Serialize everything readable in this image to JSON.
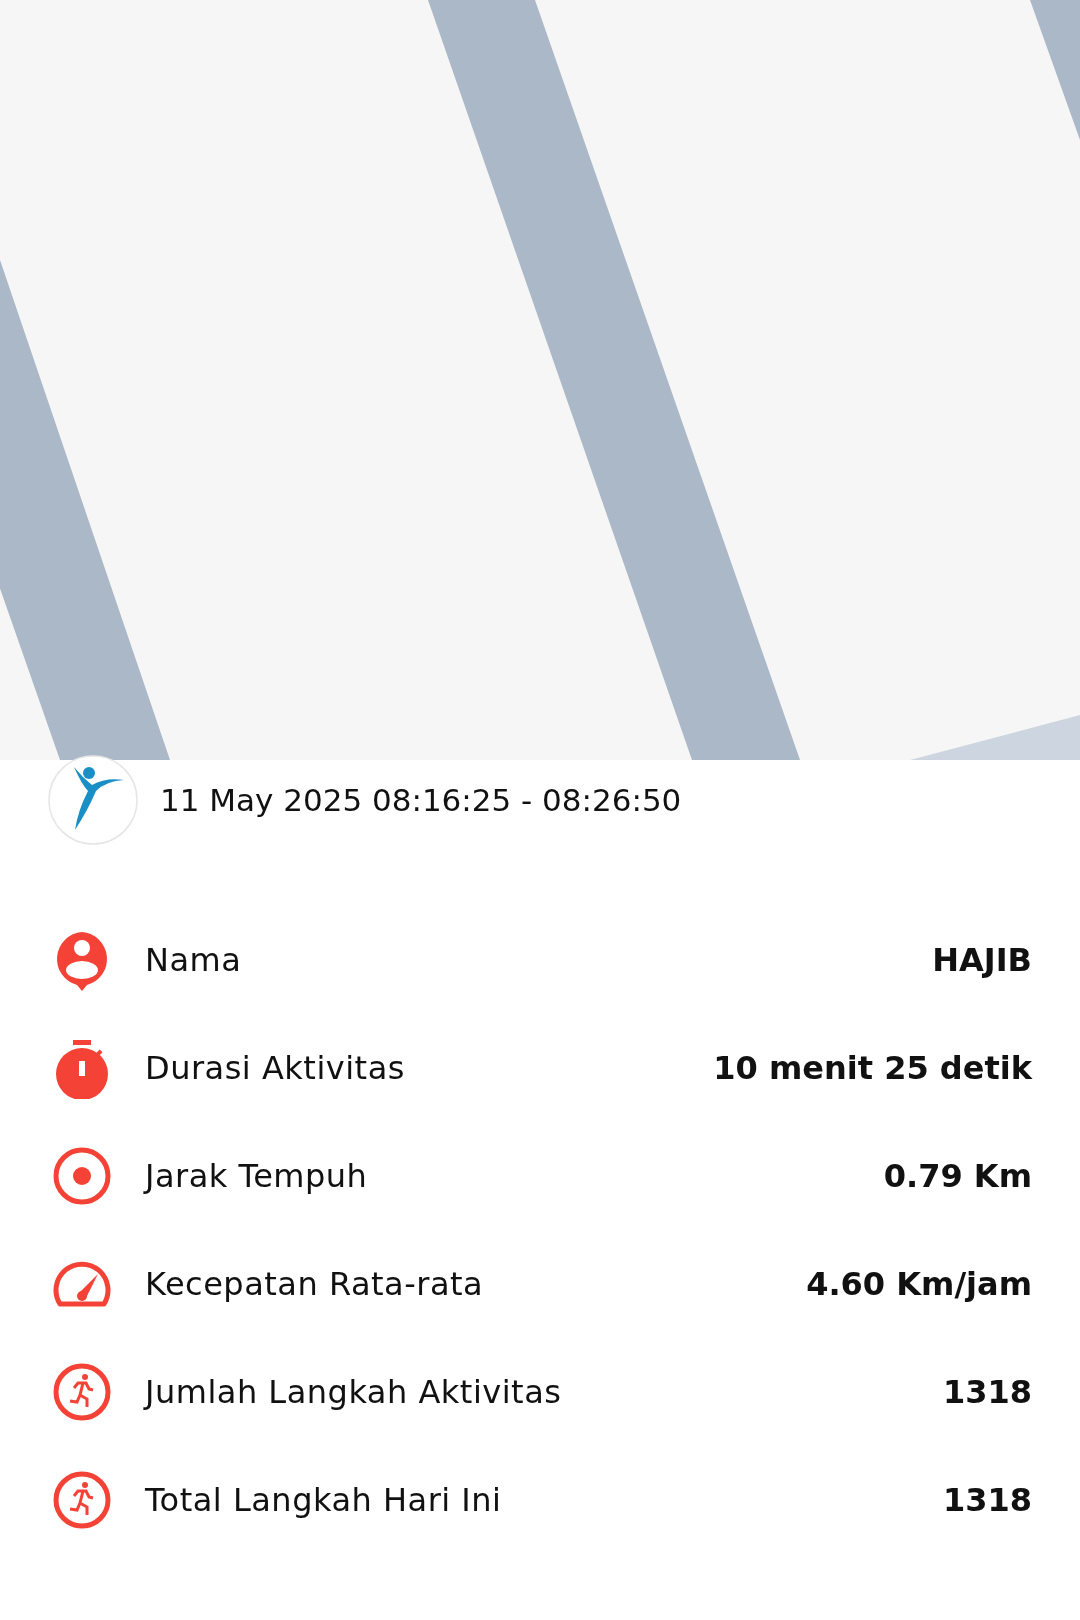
{
  "activity": {
    "time_range": "11 May 2025 08:16:25 - 08:26:50"
  },
  "stats": [
    {
      "kind": "person",
      "label": "Nama",
      "value": "HAJIB"
    },
    {
      "kind": "timer",
      "label": "Durasi Aktivitas",
      "value": "10 menit 25 detik"
    },
    {
      "kind": "target",
      "label": "Jarak Tempuh",
      "value": "0.79 Km"
    },
    {
      "kind": "speed",
      "label": "Kecepatan Rata-rata",
      "value": "4.60 Km/jam"
    },
    {
      "kind": "steps",
      "label": "Jumlah Langkah Aktivitas",
      "value": "1318"
    },
    {
      "kind": "steps",
      "label": "Total Langkah Hari Ini",
      "value": "1318"
    }
  ]
}
